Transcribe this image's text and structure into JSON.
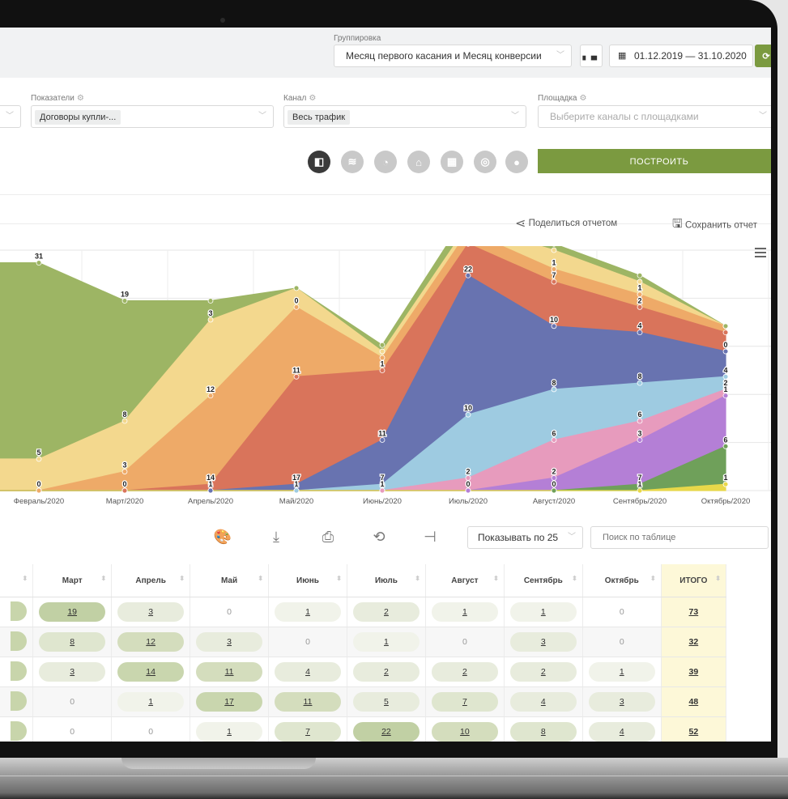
{
  "grouping": {
    "label": "Группировка",
    "value": "Месяц первого касания и Месяц конверсии",
    "date_range": "01.12.2019 — 31.10.2020"
  },
  "filters": {
    "metrics": {
      "label": "Показатели",
      "value": "Договоры купли-..."
    },
    "channel": {
      "label": "Канал",
      "value": "Весь трафик"
    },
    "platform": {
      "label": "Площадка",
      "placeholder": "Выберите каналы с площадками"
    }
  },
  "build_button": "ПОСТРОИТЬ",
  "actions": {
    "share": "Поделиться отчетом",
    "save": "Сохранить отчет"
  },
  "chart_data": {
    "type": "area",
    "stacked": true,
    "categories": [
      "Февраль/2020",
      "Март/2020",
      "Апрель/2020",
      "Май/2020",
      "Июнь/2020",
      "Июль/2020",
      "Август/2020",
      "Сентябрь/2020",
      "Октябрь/2020"
    ],
    "series": [
      {
        "color": "#e8d84a",
        "values": [
          0,
          0,
          0,
          0,
          0,
          0,
          0,
          0,
          1
        ]
      },
      {
        "color": "#6fa05a",
        "values": [
          0,
          0,
          0,
          0,
          0,
          0,
          0,
          1,
          6
        ]
      },
      {
        "color": "#b47fd6",
        "values": [
          0,
          0,
          0,
          0,
          0,
          0,
          2,
          7,
          8
        ]
      },
      {
        "color": "#e79bbd",
        "values": [
          0,
          0,
          0,
          0,
          0,
          2,
          6,
          3,
          1
        ]
      },
      {
        "color": "#9ecbe1",
        "values": [
          0,
          0,
          0,
          0,
          1,
          10,
          8,
          6,
          2
        ]
      },
      {
        "color": "#6873b0",
        "values": [
          0,
          0,
          0,
          1,
          7,
          22,
          10,
          8,
          4
        ]
      },
      {
        "color": "#d9745b",
        "values": [
          0,
          0,
          1,
          17,
          11,
          5,
          7,
          4,
          3
        ]
      },
      {
        "color": "#eeaa68",
        "values": [
          0,
          3,
          14,
          11,
          2,
          2,
          2,
          2,
          1
        ]
      },
      {
        "color": "#f3d88e",
        "values": [
          5,
          8,
          12,
          3,
          1,
          1,
          3,
          2,
          0
        ]
      },
      {
        "color": "#9db564",
        "values": [
          31,
          19,
          3,
          0,
          1,
          2,
          1,
          1,
          0
        ]
      }
    ],
    "value_labels": [
      [
        "0",
        "5",
        "31"
      ],
      [
        "0",
        "3",
        "8",
        "19"
      ],
      [
        "1",
        "14",
        "12",
        "3"
      ],
      [
        "1",
        "17",
        "11",
        "0"
      ],
      [
        "1",
        "7",
        "11",
        "1"
      ],
      [
        "0",
        "2",
        "10",
        "22",
        "5",
        "1",
        "2"
      ],
      [
        "0",
        "2",
        "6",
        "8",
        "10",
        "7",
        "1"
      ],
      [
        "1",
        "7",
        "3",
        "6",
        "8",
        "4",
        "2",
        "1"
      ],
      [
        "1",
        "6",
        "1",
        "2",
        "4",
        "0"
      ]
    ]
  },
  "toolbar": {
    "page_size": "Показывать по 25",
    "search_placeholder": "Поиск по таблице"
  },
  "table": {
    "columns": [
      "Март",
      "Апрель",
      "Май",
      "Июнь",
      "Июль",
      "Август",
      "Сентябрь",
      "Октябрь",
      "ИТОГО"
    ],
    "rows": [
      [
        "19",
        "3",
        "0",
        "1",
        "2",
        "1",
        "1",
        "0",
        "73"
      ],
      [
        "8",
        "12",
        "3",
        "0",
        "1",
        "0",
        "3",
        "0",
        "32"
      ],
      [
        "3",
        "14",
        "11",
        "4",
        "2",
        "2",
        "2",
        "1",
        "39"
      ],
      [
        "0",
        "1",
        "17",
        "11",
        "5",
        "7",
        "4",
        "3",
        "48"
      ],
      [
        "0",
        "0",
        "1",
        "7",
        "22",
        "10",
        "8",
        "4",
        "52"
      ]
    ]
  }
}
